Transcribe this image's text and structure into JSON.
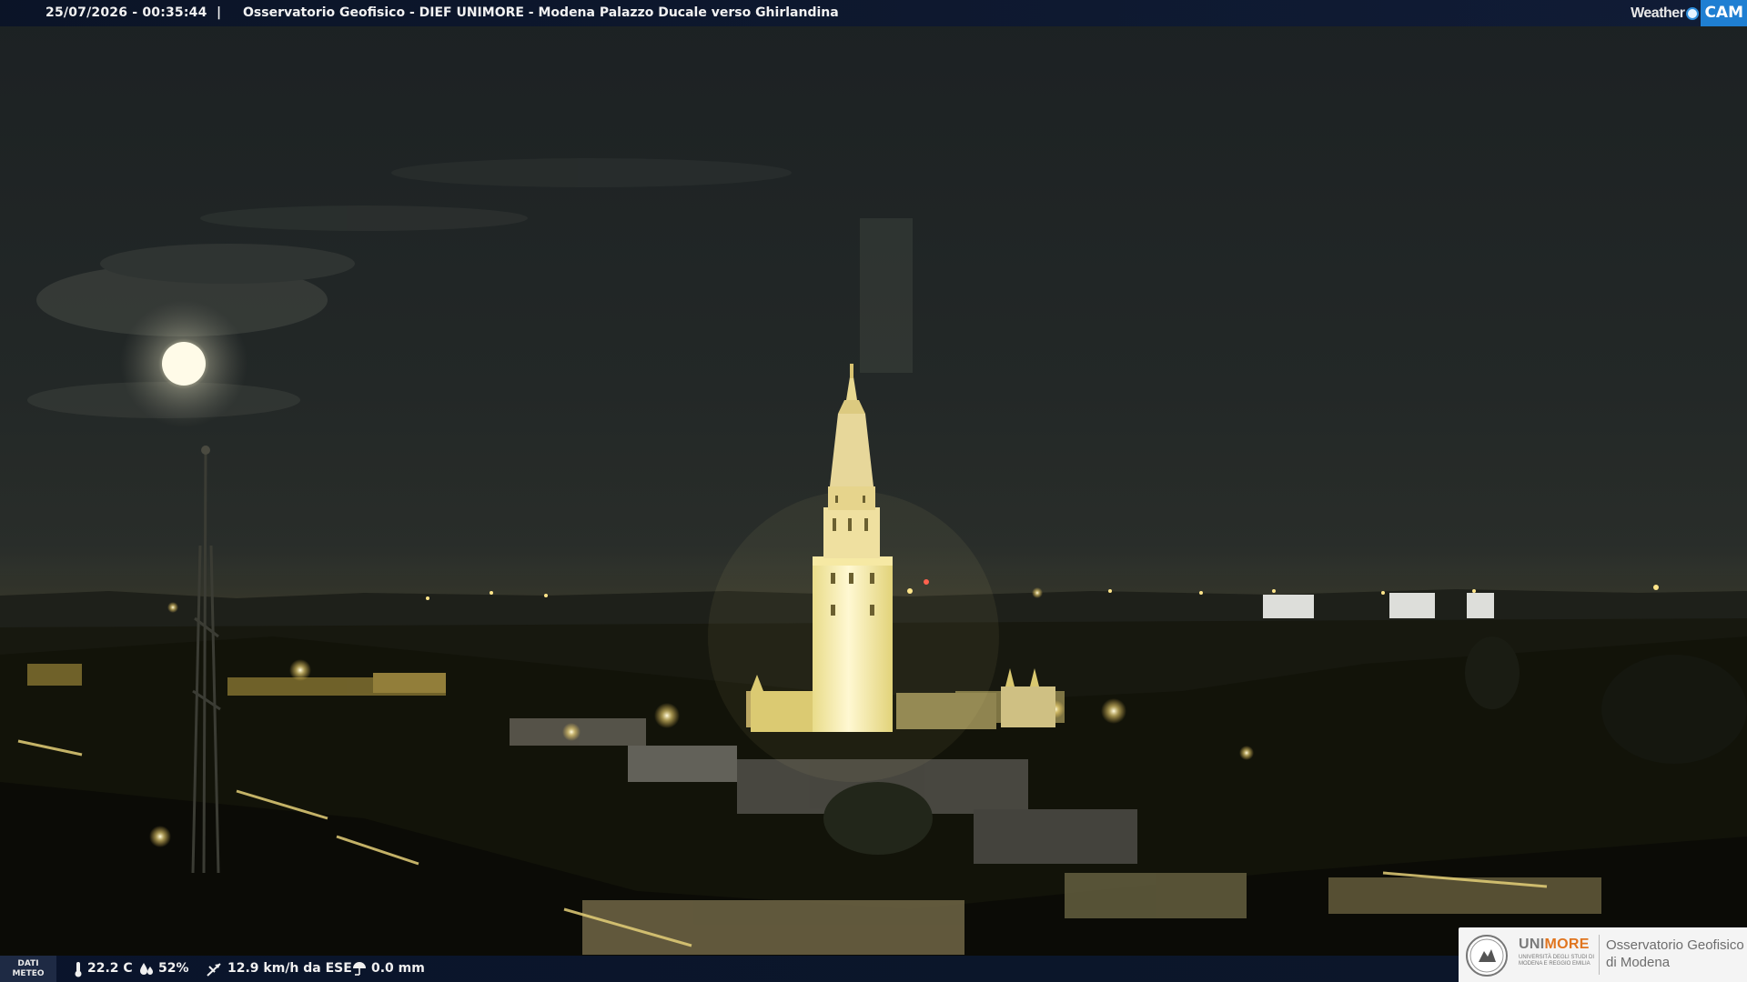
{
  "overlay": {
    "timestamp": "25/07/2026 - 00:35:44",
    "separator": "|",
    "title": "Osservatorio Geofisico - DIEF UNIMORE - Modena Palazzo Ducale verso Ghirlandina",
    "brand_left": "Weather",
    "brand_right": "CAM"
  },
  "weather": {
    "label_line1": "DATI",
    "label_line2": "METEO",
    "temperature": "22.2 C",
    "humidity": "52%",
    "wind": "12.9 km/h da ESE",
    "rain": "0.0 mm",
    "icons": [
      "thermometer-icon",
      "humidity-drops-icon",
      "wind-vane-icon",
      "rain-gauge-icon"
    ]
  },
  "logo": {
    "uni_grey": "UNI",
    "uni_orange": "MORE",
    "uni_sub": "UNIVERSITÀ DEGLI STUDI DI MODENA E REGGIO EMILIA",
    "obs_line1": "Osservatorio Geofisico",
    "obs_line2": "di Modena"
  },
  "colors": {
    "sky": "#23282a",
    "tower_light": "#fff6c8",
    "city_lights": "#ffd866",
    "bar_blue": "#0c1a3c",
    "brand_blue": "#1f7fd2",
    "unimore_orange": "#e0751f"
  }
}
